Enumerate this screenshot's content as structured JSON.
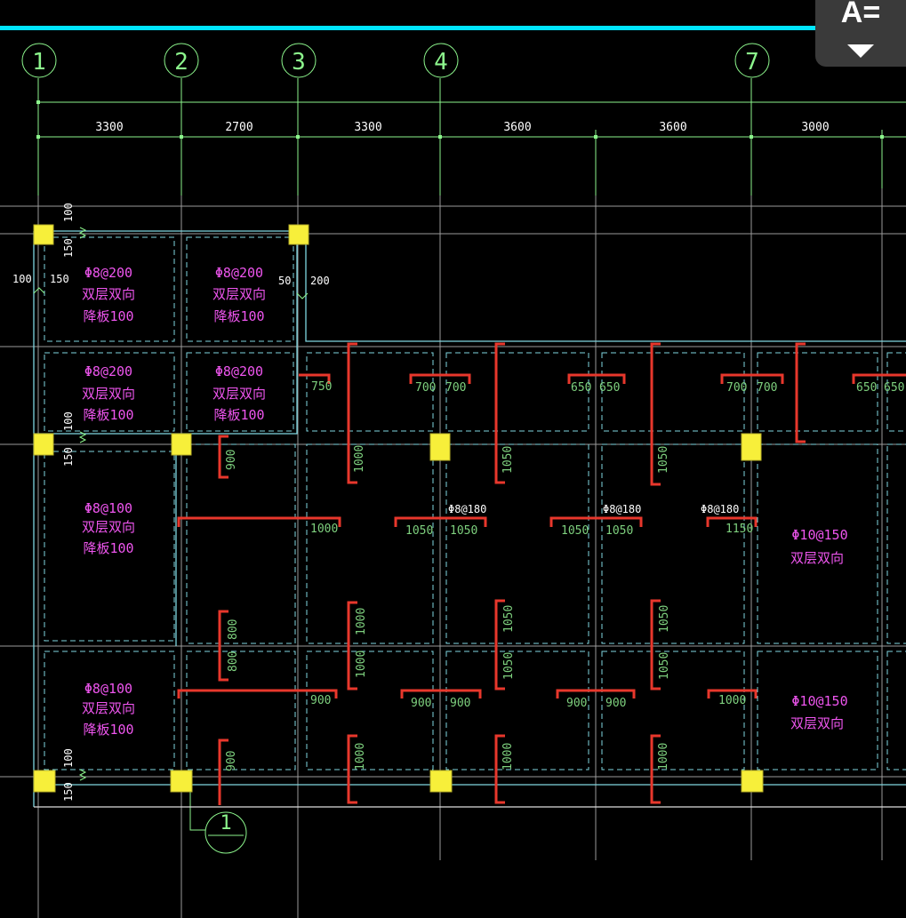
{
  "axes": [
    {
      "label": "1"
    },
    {
      "label": "2"
    },
    {
      "label": "3"
    },
    {
      "label": "4"
    },
    {
      "label": "7"
    }
  ],
  "spans": [
    "3300",
    "2700",
    "3300",
    "3600",
    "3600",
    "3000"
  ],
  "section_marker": {
    "label": "1"
  },
  "edge_dims": {
    "top_100": "100",
    "top_150": "150",
    "mid_100": "100",
    "mid_150": "150",
    "bot_100": "100",
    "bot_150": "150",
    "left_100": "100",
    "left_150": "150",
    "right_50": "50",
    "right_200": "200"
  },
  "slab_labels": [
    {
      "rebar": "Φ8@200",
      "layer": "双层双向",
      "drop": "降板100"
    },
    {
      "rebar": "Φ8@200",
      "layer": "双层双向",
      "drop": "降板100"
    },
    {
      "rebar": "Φ8@200",
      "layer": "双层双向",
      "drop": "降板100"
    },
    {
      "rebar": "Φ8@200",
      "layer": "双层双向",
      "drop": "降板100"
    },
    {
      "rebar": "Φ8@100",
      "layer": "双层双向",
      "drop": "降板100"
    },
    {
      "rebar": "Φ8@100",
      "layer": "双层双向",
      "drop": "降板100"
    },
    {
      "rebar": "Φ10@150",
      "layer": "双层双向"
    },
    {
      "rebar": "Φ10@150",
      "layer": "双层双向"
    }
  ],
  "bar_labels": [
    "Φ8@180",
    "Φ8@180",
    "Φ8@180"
  ],
  "rebar_dims": [
    "750",
    "700",
    "700",
    "650",
    "650",
    "700",
    "700",
    "650",
    "650",
    "900",
    "1000",
    "1050",
    "1050",
    "1000",
    "1050",
    "1050",
    "1050",
    "1050",
    "1150",
    "800",
    "800",
    "1000",
    "1000",
    "1050",
    "1050",
    "1050",
    "1050",
    "900",
    "900",
    "900",
    "900",
    "900",
    "1000",
    "900",
    "1000",
    "1000",
    "1000"
  ],
  "toolbar": {
    "text_style_label": "A=",
    "dropdown_icon": "triangle-down-icon"
  },
  "colors": {
    "axis": "#8cf58c",
    "grid": "#9a9a9a",
    "slab": "#7fd6e0",
    "rebar": "#e8372c",
    "column": "#f7ef3a",
    "text_magenta": "#ee55ee",
    "text_green": "#7ed07e",
    "text_white": "#ffffff",
    "top_bar": "#00e5ff"
  }
}
